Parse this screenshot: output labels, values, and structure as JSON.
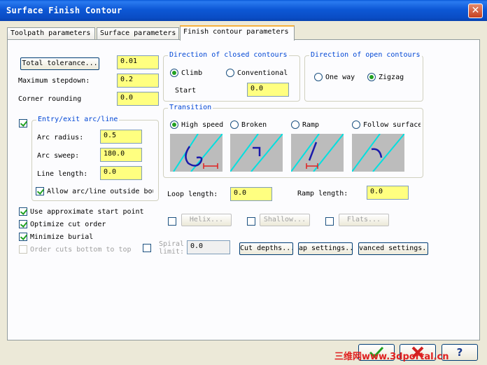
{
  "window": {
    "title": "Surface Finish Contour",
    "close": "✕"
  },
  "tabs": [
    {
      "label": "Toolpath parameters"
    },
    {
      "label": "Surface parameters"
    },
    {
      "label": "Finish contour parameters"
    }
  ],
  "left": {
    "total_tolerance_btn": "Total tolerance...",
    "total_tolerance": "0.01",
    "max_stepdown_label": "Maximum stepdown:",
    "max_stepdown": "0.2",
    "corner_rounding_label": "Corner rounding",
    "corner_rounding": "0.0"
  },
  "entry_exit": {
    "label": "Entry/exit arc/line",
    "arc_radius_label": "Arc radius:",
    "arc_radius": "0.5",
    "arc_sweep_label": "Arc sweep:",
    "arc_sweep": "180.0",
    "line_length_label": "Line length:",
    "line_length": "0.0",
    "allow_outside_label": "Allow arc/line outside bou"
  },
  "closed_contours": {
    "label": "Direction of closed contours",
    "climb": "Climb",
    "conventional": "Conventional",
    "start_label": "Start",
    "start": "0.0"
  },
  "open_contours": {
    "label": "Direction of open contours",
    "one_way": "One way",
    "zigzag": "Zigzag"
  },
  "transition": {
    "label": "Transition",
    "high_speed": "High speed",
    "broken": "Broken",
    "ramp": "Ramp",
    "follow_surface": "Follow surface",
    "loop_length_label": "Loop length:",
    "loop_length": "0.0",
    "ramp_length_label": "Ramp length:",
    "ramp_length": "0.0"
  },
  "options": {
    "approx_start": "Use approximate start point",
    "optimize_cut": "Optimize cut order",
    "minimize_burial": "Minimize burial",
    "order_cuts": "Order cuts bottom to top",
    "spiral_label": "Spiral limit:",
    "spiral_value": "0.0"
  },
  "buttons": {
    "helix": "Helix...",
    "shallow": "Shallow...",
    "flats": "Flats...",
    "cut_depths": "Cut depths...",
    "gap_settings": "ap settings...",
    "advanced": "vanced settings..."
  },
  "dialog": {
    "help": "?"
  },
  "watermark": "三维网www.3dportal.cn",
  "colors": {
    "field": "#ffff80",
    "accent": "#0046d5",
    "preview": "#bcbcbc",
    "path": "#1a1aaa",
    "guide": "#00e0e0"
  }
}
